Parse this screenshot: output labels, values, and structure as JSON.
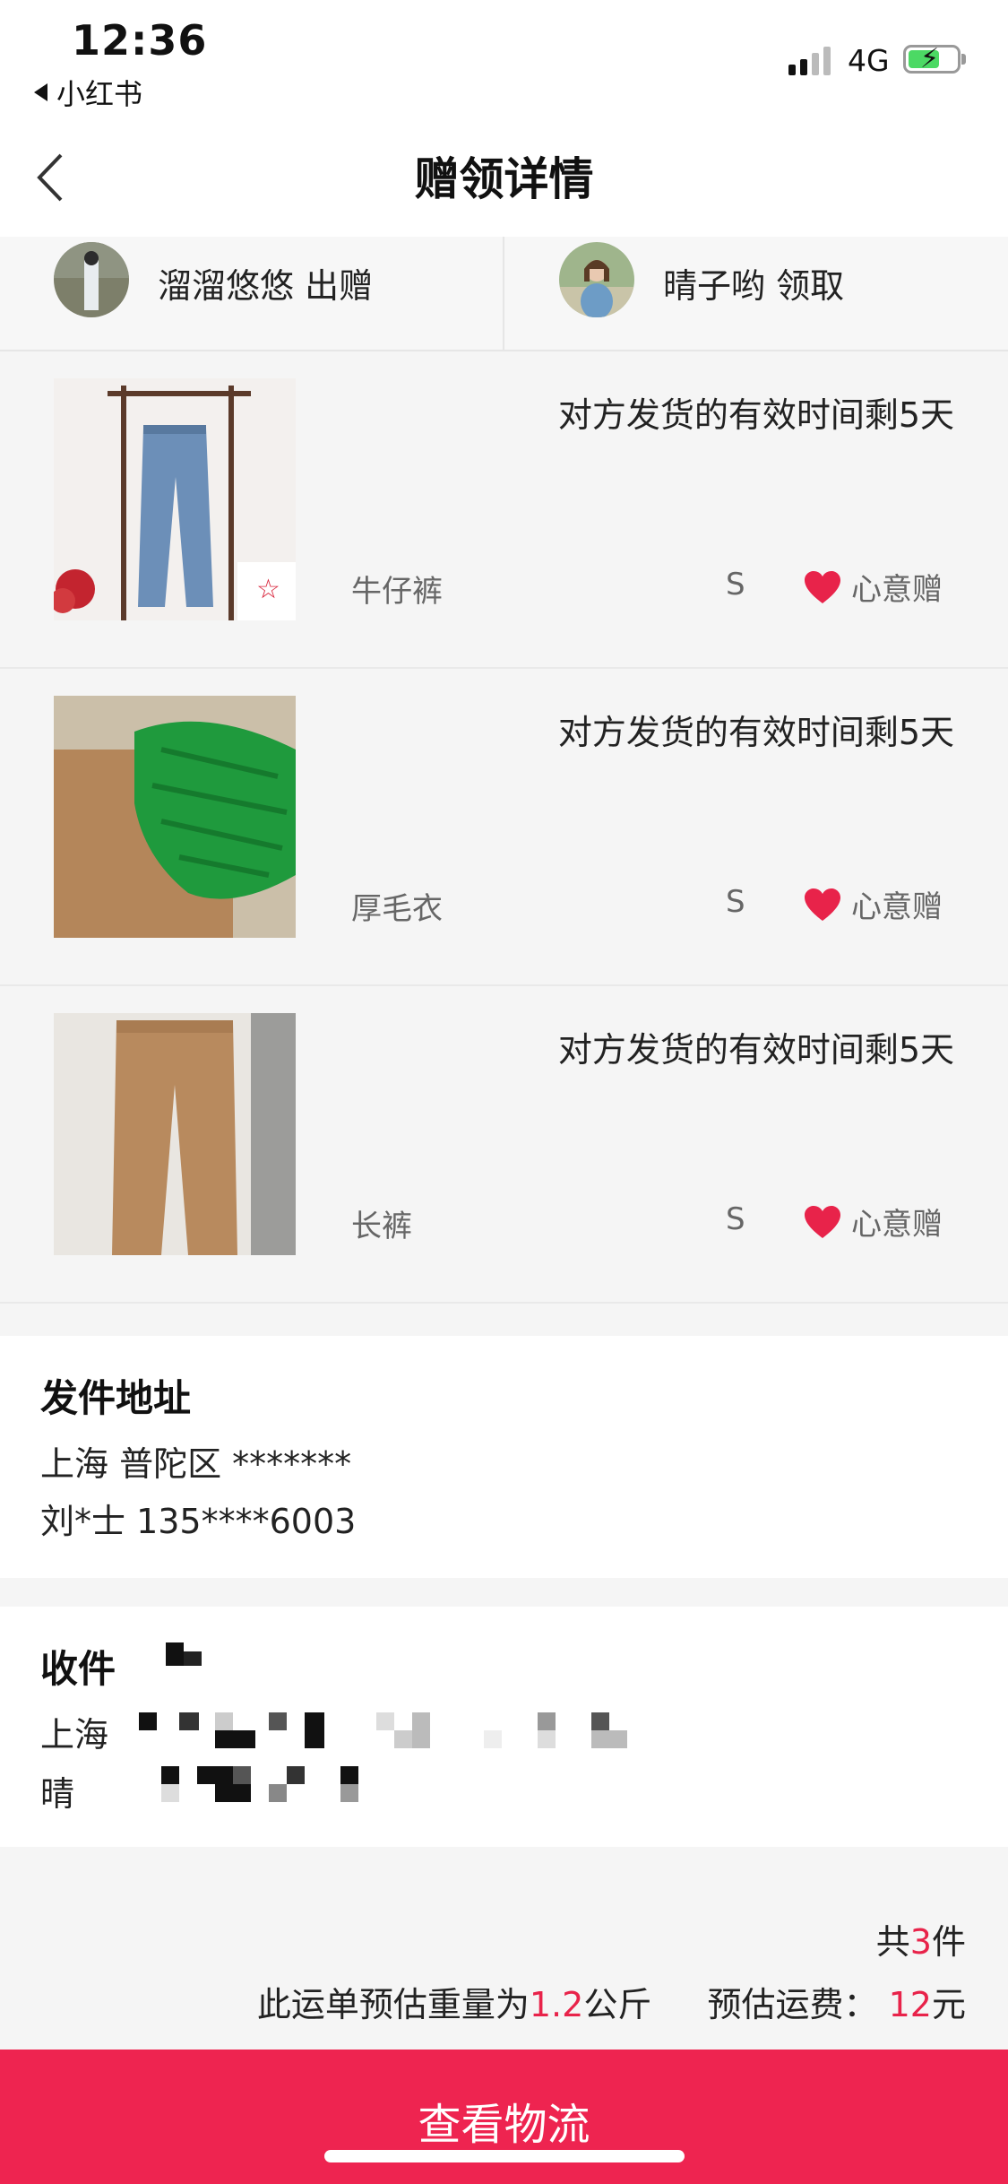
{
  "status_bar": {
    "time": "12:36",
    "back_app": "小红书",
    "network": "4G"
  },
  "nav": {
    "title": "赠领详情",
    "back_icon": "chevron-left-icon"
  },
  "giver": {
    "name": "溜溜悠悠",
    "action": "出赠"
  },
  "receiver": {
    "name": "晴子哟",
    "action": "领取"
  },
  "items": [
    {
      "deadline": "对方发货的有效时间剩5天",
      "name": "牛仔裤",
      "size": "S",
      "tag": "心意赠"
    },
    {
      "deadline": "对方发货的有效时间剩5天",
      "name": "厚毛衣",
      "size": "S",
      "tag": "心意赠"
    },
    {
      "deadline": "对方发货的有效时间剩5天",
      "name": "长裤",
      "size": "S",
      "tag": "心意赠"
    }
  ],
  "sender_address": {
    "title": "发件地址",
    "line1": "上海 普陀区 *******",
    "line2": "刘*士 135****6003"
  },
  "receiver_address": {
    "title": "收件",
    "line1": "上海",
    "line2": "晴"
  },
  "summary": {
    "count_prefix": "共",
    "count": "3",
    "count_suffix": "件",
    "weight_prefix": "此运单预估重量为",
    "weight": "1.2",
    "weight_unit": "公斤",
    "fee_label": "预估运费：",
    "fee": "12",
    "fee_unit": "元"
  },
  "cta": {
    "label": "查看物流"
  },
  "colors": {
    "accent": "#ee2450",
    "heart": "#e8234a",
    "background": "#f5f5f5"
  }
}
